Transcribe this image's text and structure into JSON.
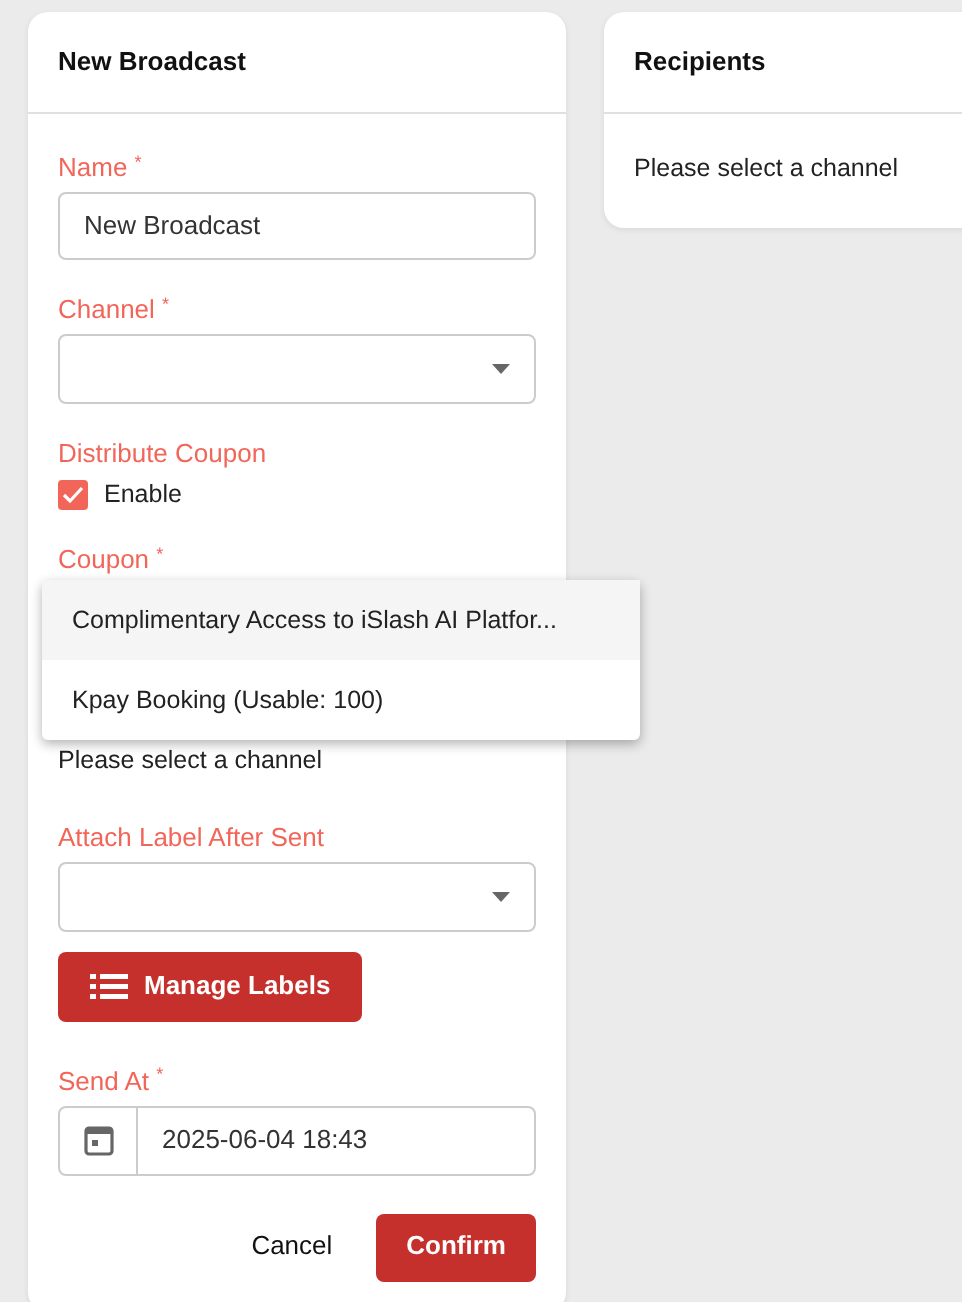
{
  "broadcast_card": {
    "title": "New Broadcast",
    "name_field": {
      "label": "Name $^{*}$",
      "value": "New Broadcast"
    },
    "channel_field": {
      "label": "Channel $^{*}$"
    },
    "distribute_coupon": {
      "label": "Distribute Coupon",
      "option": "Enable",
      "checked": true
    },
    "coupon_field": {
      "label": "Coupon $^{*}$",
      "hint": "Please select a channel"
    },
    "coupon_menu": [
      {
        "label": "Complimentary Access to iSlash AI Platfor...",
        "selected": true
      },
      {
        "label": "Kpay Booking (Usable: 100)",
        "selected": false
      }
    ],
    "label_field": {
      "label": "Attach Label After Sent"
    },
    "manage_labels_button": "Manage Labels",
    "send_at_field": {
      "label": "Send At $^{*}$",
      "value": "2025-06-04 18:43"
    },
    "buttons": [
      "Cancel",
      "Confirm"
    ]
  },
  "recipients_card": {
    "title": "Recipients",
    "message": "Please select a channel"
  }
}
